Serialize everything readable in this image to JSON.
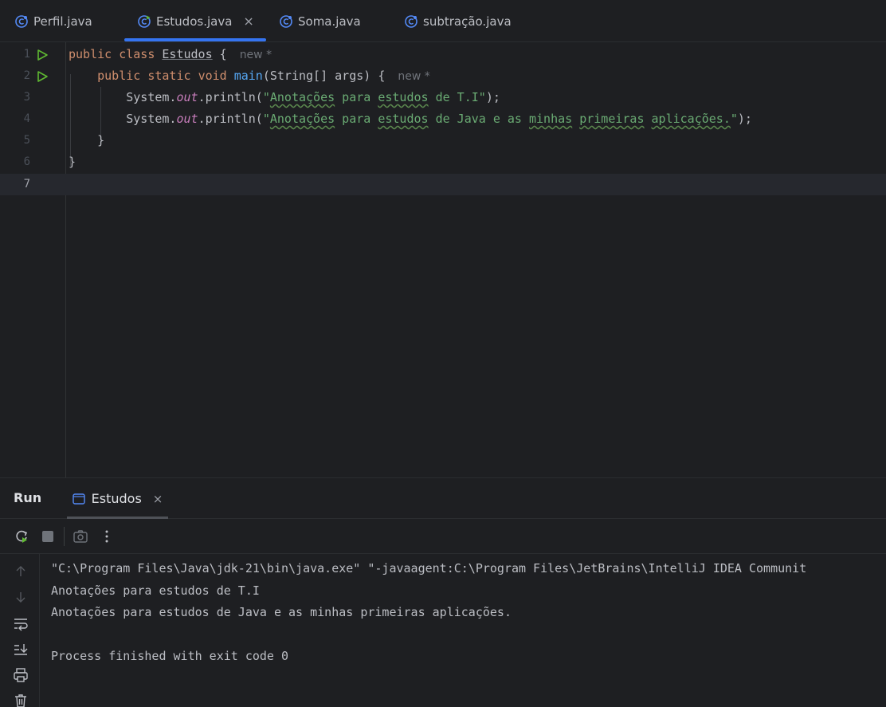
{
  "tabs": [
    {
      "label": "Perfil.java",
      "active": false,
      "icon": "java-class-icon"
    },
    {
      "label": "Estudos.java",
      "active": true,
      "icon": "java-class-icon",
      "close": "×"
    },
    {
      "label": "Soma.java",
      "active": false,
      "icon": "java-class-icon"
    },
    {
      "label": "subtração.java",
      "active": false,
      "icon": "java-class-icon"
    }
  ],
  "editor": {
    "lines": [
      {
        "n": "1",
        "run": true
      },
      {
        "n": "2",
        "run": true
      },
      {
        "n": "3"
      },
      {
        "n": "4"
      },
      {
        "n": "5"
      },
      {
        "n": "6"
      },
      {
        "n": "7",
        "current": true
      }
    ],
    "code": {
      "l1_public": "public",
      "l1_class": "class",
      "l1_name": "Estudos",
      "l1_brace": " {",
      "l1_hint": "new *",
      "l2_public": "public",
      "l2_static": "static",
      "l2_void": "void",
      "l2_main": "main",
      "l2_args": "(String[] args) {",
      "l2_hint": "new *",
      "sys": "System.",
      "out": "out",
      "println": ".println(",
      "l3_q1": "\"",
      "l3_w1": "Anotações",
      "l3_mid1": " para ",
      "l3_w2": "estudos",
      "l3_mid2": " de T.I\"",
      "end": ");",
      "l4_q1": "\"",
      "l4_w1": "Anotações",
      "l4_mid1": " para ",
      "l4_w2": "estudos",
      "l4_mid2": " de Java e as ",
      "l4_w3": "minhas",
      "l4_sp1": " ",
      "l4_w4": "primeiras",
      "l4_sp2": " ",
      "l4_w5": "aplicações.",
      "l4_q2": "\"",
      "l5": "}",
      "l6": "}"
    }
  },
  "run": {
    "title": "Run",
    "tab_label": "Estudos",
    "tab_close": "×",
    "console": [
      "\"C:\\Program Files\\Java\\jdk-21\\bin\\java.exe\" \"-javaagent:C:\\Program Files\\JetBrains\\IntelliJ IDEA Communit",
      "Anotações para estudos de T.I",
      "Anotações para estudos de Java e as minhas primeiras aplicações.",
      "",
      "Process finished with exit code 0"
    ]
  },
  "colors": {
    "accent": "#3574f0",
    "keyword": "#cf8e6d",
    "string": "#6aab73",
    "method": "#56a8f5",
    "field": "#c77dbb",
    "background": "#1e1f22"
  }
}
